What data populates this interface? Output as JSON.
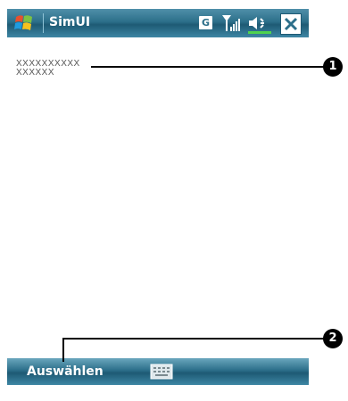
{
  "titlebar": {
    "app_title": "SimUI",
    "network_badge": "G"
  },
  "content": {
    "item": {
      "line1": "XXXXXXXXXX",
      "line2": "XXXXXX"
    }
  },
  "bottombar": {
    "softkey_left": "Auswählen"
  },
  "callouts": [
    {
      "number": "1"
    },
    {
      "number": "2"
    }
  ],
  "icons": [
    "windows-start-icon",
    "signal-strength-icon",
    "volume-icon",
    "close-icon",
    "keyboard-icon"
  ],
  "colors": {
    "title_bar": "#2c6f8a",
    "bottom_bar": "#2c6f8a",
    "background": "#ffffff"
  }
}
